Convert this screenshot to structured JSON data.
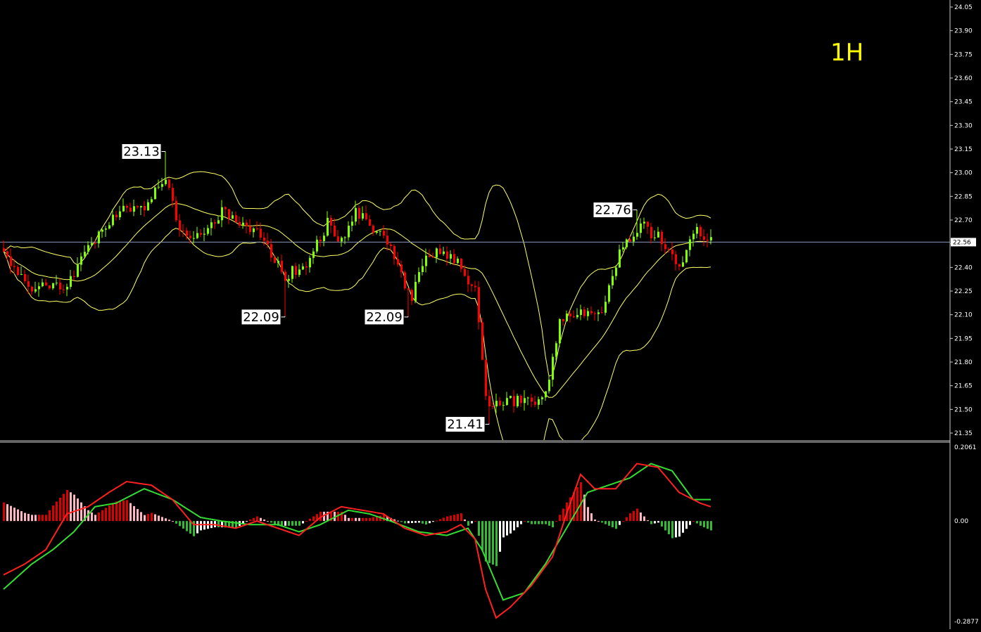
{
  "timeframe_label": "1H",
  "colors": {
    "background": "#000000",
    "axis_text": "#ffffff",
    "bull_candle": "#7fff00",
    "bear_candle": "#ff0000",
    "bollinger": "#ffff66",
    "timeframe": "#ffff00",
    "current_price_line": "#8899bb",
    "macd_line": "#ff2020",
    "signal_line": "#33dd33",
    "hist_pos_strong": "#dd0000",
    "hist_pos_weak": "#ffb6c1",
    "hist_neg_strong": "#33bb33",
    "hist_neg_weak": "#ffffff"
  },
  "chart_data": [
    {
      "type": "candlestick",
      "price_axis": {
        "range": [
          21.3,
          24.1
        ],
        "ticks": [
          "24.05",
          "23.90",
          "23.75",
          "23.60",
          "23.45",
          "23.30",
          "23.15",
          "23.00",
          "22.85",
          "22.70",
          "22.55",
          "22.40",
          "22.25",
          "22.10",
          "21.95",
          "21.80",
          "21.65",
          "21.50",
          "21.35"
        ],
        "current_price": "22.56"
      },
      "indicators": [
        "bollinger_bands"
      ],
      "annotations": [
        {
          "label": "23.13",
          "bar": 46,
          "price": 23.13,
          "kind": "high"
        },
        {
          "label": "22.09",
          "bar": 80,
          "price": 22.09,
          "kind": "low"
        },
        {
          "label": "22.09",
          "bar": 115,
          "price": 22.09,
          "kind": "low"
        },
        {
          "label": "21.41",
          "bar": 138,
          "price": 21.41,
          "kind": "low"
        },
        {
          "label": "22.76",
          "bar": 180,
          "price": 22.76,
          "kind": "high"
        }
      ],
      "close_path": [
        [
          0,
          22.48
        ],
        [
          8,
          22.28
        ],
        [
          12,
          22.3
        ],
        [
          18,
          22.28
        ],
        [
          25,
          22.55
        ],
        [
          32,
          22.75
        ],
        [
          40,
          22.8
        ],
        [
          46,
          22.98
        ],
        [
          50,
          22.62
        ],
        [
          56,
          22.6
        ],
        [
          62,
          22.75
        ],
        [
          72,
          22.63
        ],
        [
          80,
          22.35
        ],
        [
          86,
          22.42
        ],
        [
          92,
          22.68
        ],
        [
          96,
          22.55
        ],
        [
          100,
          22.74
        ],
        [
          108,
          22.6
        ],
        [
          112,
          22.4
        ],
        [
          116,
          22.2
        ],
        [
          120,
          22.5
        ],
        [
          126,
          22.48
        ],
        [
          130,
          22.4
        ],
        [
          134,
          22.25
        ],
        [
          137,
          21.55
        ],
        [
          142,
          21.55
        ],
        [
          150,
          21.55
        ],
        [
          154,
          21.6
        ],
        [
          158,
          22.05
        ],
        [
          164,
          22.12
        ],
        [
          170,
          22.1
        ],
        [
          176,
          22.55
        ],
        [
          182,
          22.66
        ],
        [
          188,
          22.55
        ],
        [
          192,
          22.4
        ],
        [
          196,
          22.65
        ],
        [
          201,
          22.58
        ]
      ]
    },
    {
      "type": "macd",
      "value_axis": {
        "range": [
          -0.2877,
          0.2061
        ],
        "ticks": [
          "0.2061",
          "0.00",
          "-0.2877"
        ]
      },
      "macd_path": [
        [
          0,
          -0.15
        ],
        [
          6,
          -0.12
        ],
        [
          12,
          -0.08
        ],
        [
          18,
          0.02
        ],
        [
          24,
          0.04
        ],
        [
          30,
          0.08
        ],
        [
          35,
          0.11
        ],
        [
          42,
          0.1
        ],
        [
          48,
          0.06
        ],
        [
          54,
          -0.01
        ],
        [
          60,
          -0.01
        ],
        [
          66,
          -0.02
        ],
        [
          72,
          0.0
        ],
        [
          78,
          -0.02
        ],
        [
          84,
          -0.04
        ],
        [
          90,
          0.01
        ],
        [
          96,
          0.04
        ],
        [
          102,
          0.03
        ],
        [
          108,
          0.02
        ],
        [
          114,
          -0.02
        ],
        [
          120,
          -0.04
        ],
        [
          126,
          -0.03
        ],
        [
          130,
          -0.01
        ],
        [
          134,
          -0.05
        ],
        [
          137,
          -0.19
        ],
        [
          140,
          -0.27
        ],
        [
          144,
          -0.24
        ],
        [
          150,
          -0.18
        ],
        [
          156,
          -0.1
        ],
        [
          160,
          0.02
        ],
        [
          164,
          0.13
        ],
        [
          168,
          0.09
        ],
        [
          174,
          0.09
        ],
        [
          180,
          0.16
        ],
        [
          186,
          0.15
        ],
        [
          192,
          0.08
        ],
        [
          198,
          0.05
        ],
        [
          201,
          0.04
        ]
      ],
      "signal_path": [
        [
          0,
          -0.19
        ],
        [
          8,
          -0.12
        ],
        [
          14,
          -0.08
        ],
        [
          20,
          -0.03
        ],
        [
          26,
          0.04
        ],
        [
          32,
          0.05
        ],
        [
          40,
          0.09
        ],
        [
          48,
          0.06
        ],
        [
          56,
          0.01
        ],
        [
          62,
          0.0
        ],
        [
          70,
          -0.01
        ],
        [
          78,
          -0.01
        ],
        [
          84,
          -0.03
        ],
        [
          90,
          -0.01
        ],
        [
          98,
          0.03
        ],
        [
          104,
          0.02
        ],
        [
          110,
          0.0
        ],
        [
          118,
          -0.03
        ],
        [
          126,
          -0.04
        ],
        [
          132,
          -0.02
        ],
        [
          136,
          -0.08
        ],
        [
          142,
          -0.22
        ],
        [
          148,
          -0.2
        ],
        [
          154,
          -0.12
        ],
        [
          160,
          -0.02
        ],
        [
          166,
          0.08
        ],
        [
          172,
          0.1
        ],
        [
          178,
          0.12
        ],
        [
          184,
          0.16
        ],
        [
          190,
          0.14
        ],
        [
          196,
          0.06
        ],
        [
          201,
          0.06
        ]
      ]
    }
  ]
}
